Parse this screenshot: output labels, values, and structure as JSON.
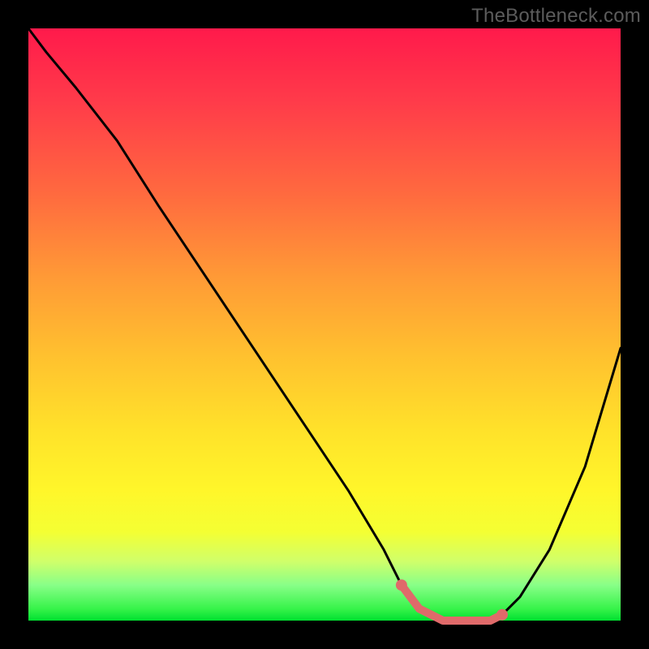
{
  "watermark": "TheBottleneck.com",
  "chart_data": {
    "type": "line",
    "title": "",
    "xlabel": "",
    "ylabel": "",
    "xlim": [
      0,
      100
    ],
    "ylim": [
      0,
      100
    ],
    "grid": false,
    "series": [
      {
        "name": "curve",
        "stroke": "#000000",
        "x": [
          0,
          3,
          8,
          15,
          22,
          30,
          38,
          46,
          54,
          60,
          63,
          66,
          70,
          74,
          78,
          80,
          83,
          88,
          94,
          100
        ],
        "y": [
          100,
          96,
          90,
          81,
          70,
          58,
          46,
          34,
          22,
          12,
          6,
          2,
          0,
          0,
          0,
          1,
          4,
          12,
          26,
          46
        ]
      }
    ],
    "highlight_segment": {
      "name": "min-plateau",
      "stroke": "#e06a6a",
      "x": [
        63,
        66,
        70,
        74,
        78,
        80
      ],
      "y": [
        6,
        2,
        0,
        0,
        0,
        1
      ],
      "endpoint_markers": true
    },
    "background": "rainbow-vertical-gradient"
  }
}
